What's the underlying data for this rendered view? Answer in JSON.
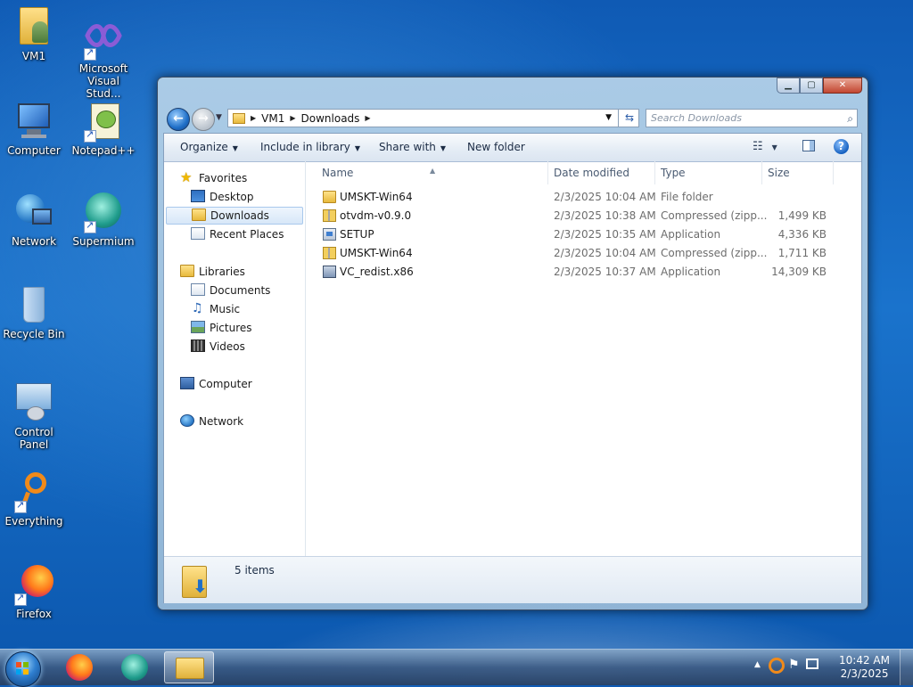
{
  "desktop": {
    "icons": [
      {
        "label": "VM1"
      },
      {
        "label": "Microsoft Visual Stud..."
      },
      {
        "label": "Computer"
      },
      {
        "label": "Notepad++"
      },
      {
        "label": "Network"
      },
      {
        "label": "Supermium"
      },
      {
        "label": "Recycle Bin"
      },
      {
        "label": "Control Panel"
      },
      {
        "label": "Everything"
      },
      {
        "label": "Firefox"
      }
    ]
  },
  "window": {
    "address": {
      "segments": [
        "VM1",
        "Downloads"
      ]
    },
    "search": {
      "placeholder": "Search Downloads"
    },
    "toolbar": {
      "organize": "Organize",
      "include_in_library": "Include in library",
      "share_with": "Share with",
      "new_folder": "New folder"
    },
    "nav": {
      "favorites": "Favorites",
      "desktop": "Desktop",
      "downloads": "Downloads",
      "recent_places": "Recent Places",
      "libraries": "Libraries",
      "documents": "Documents",
      "music": "Music",
      "pictures": "Pictures",
      "videos": "Videos",
      "computer": "Computer",
      "network": "Network"
    },
    "columns": {
      "name": "Name",
      "date": "Date modified",
      "type": "Type",
      "size": "Size"
    },
    "files": [
      {
        "name": "UMSKT-Win64",
        "date": "2/3/2025 10:04 AM",
        "type": "File folder",
        "size": "",
        "icon": "folder-icon"
      },
      {
        "name": "otvdm-v0.9.0",
        "date": "2/3/2025 10:38 AM",
        "type": "Compressed (zipp...",
        "size": "1,499 KB",
        "icon": "zip-folder-icon"
      },
      {
        "name": "SETUP",
        "date": "2/3/2025 10:35 AM",
        "type": "Application",
        "size": "4,336 KB",
        "icon": "application-icon"
      },
      {
        "name": "UMSKT-Win64",
        "date": "2/3/2025 10:04 AM",
        "type": "Compressed (zipp...",
        "size": "1,711 KB",
        "icon": "zip-folder-icon"
      },
      {
        "name": "VC_redist.x86",
        "date": "2/3/2025 10:37 AM",
        "type": "Application",
        "size": "14,309 KB",
        "icon": "installer-icon"
      }
    ],
    "status": {
      "text": "5 items"
    }
  },
  "taskbar": {
    "clock": {
      "time": "10:42 AM",
      "date": "2/3/2025"
    }
  },
  "colors": {
    "accent": "#1f6fc8",
    "selection": "#d7e7f8"
  }
}
